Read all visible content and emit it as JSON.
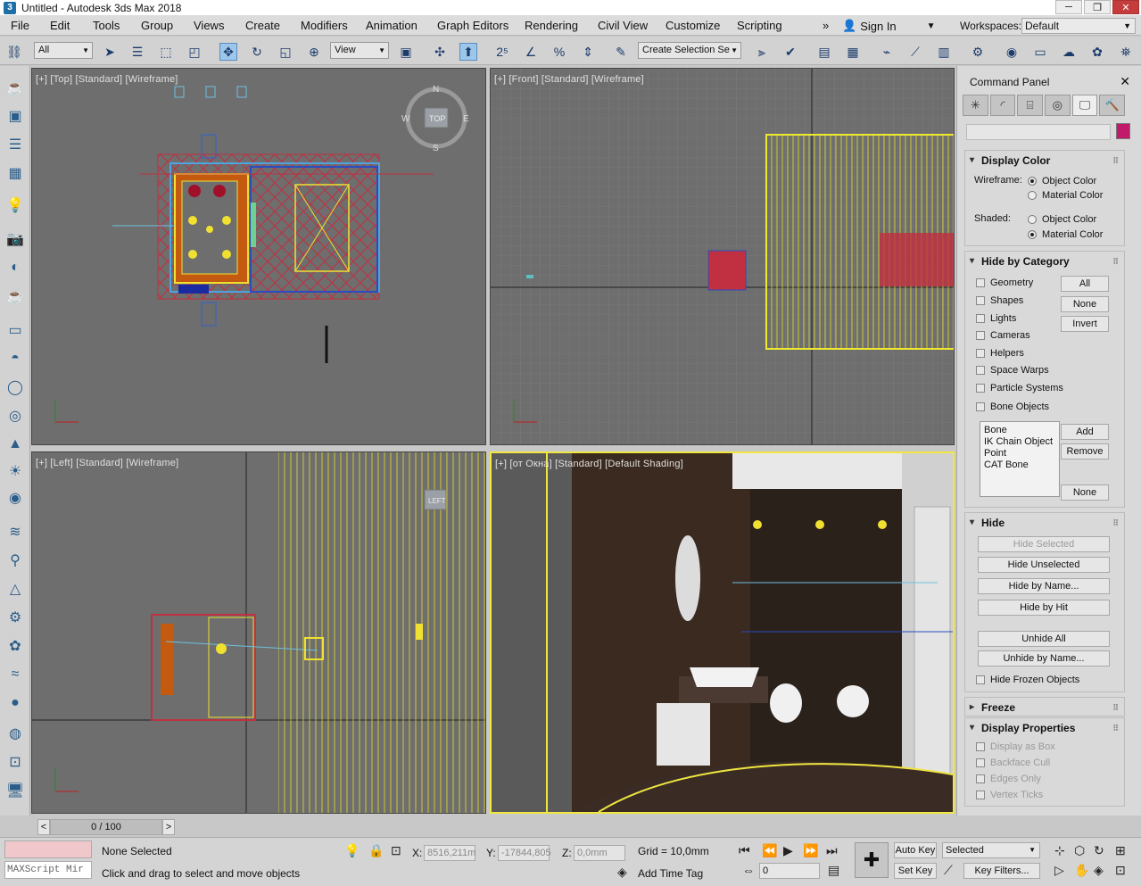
{
  "window": {
    "title": "Untitled - Autodesk 3ds Max 2018",
    "app_icon": "3"
  },
  "menu": {
    "items": [
      "File",
      "Edit",
      "Tools",
      "Group",
      "Views",
      "Create",
      "Modifiers",
      "Animation",
      "Graph Editors",
      "Rendering",
      "Civil View",
      "Customize",
      "Scripting"
    ],
    "overflow": "»",
    "sign_in": "Sign In",
    "workspaces_label": "Workspaces:",
    "workspace": "Default"
  },
  "toolbar": {
    "filter": "All",
    "ref_coord": "View",
    "selection_set": "Create Selection Se"
  },
  "viewports": {
    "top": {
      "label": "[+] [Top] [Standard] [Wireframe]",
      "cube": "TOP",
      "compass_n": "N",
      "compass_s": "S",
      "compass_e": "E",
      "compass_w": "W"
    },
    "front": {
      "label": "[+] [Front] [Standard] [Wireframe]"
    },
    "left": {
      "label": "[+] [Left] [Standard] [Wireframe]",
      "cube": "LEFT"
    },
    "persp": {
      "label": "[+] [от Окна] [Standard] [Default Shading]"
    }
  },
  "command_panel": {
    "title": "Command Panel",
    "display_color": {
      "header": "Display Color",
      "wireframe_label": "Wireframe:",
      "shaded_label": "Shaded:",
      "object_color": "Object Color",
      "material_color": "Material Color"
    },
    "hide_by_category": {
      "header": "Hide by Category",
      "items": [
        "Geometry",
        "Shapes",
        "Lights",
        "Cameras",
        "Helpers",
        "Space Warps",
        "Particle Systems",
        "Bone Objects"
      ],
      "all": "All",
      "none": "None",
      "invert": "Invert",
      "list": [
        "Bone",
        "IK Chain Object",
        "Point",
        "CAT Bone"
      ],
      "add": "Add",
      "remove": "Remove",
      "none2": "None"
    },
    "hide": {
      "header": "Hide",
      "hide_selected": "Hide Selected",
      "hide_unselected": "Hide Unselected",
      "hide_by_name": "Hide by Name...",
      "hide_by_hit": "Hide by Hit",
      "unhide_all": "Unhide All",
      "unhide_by_name": "Unhide by Name...",
      "hide_frozen": "Hide Frozen Objects"
    },
    "freeze": {
      "header": "Freeze"
    },
    "display_properties": {
      "header": "Display Properties",
      "items": [
        "Display as Box",
        "Backface Cull",
        "Edges Only",
        "Vertex Ticks"
      ]
    }
  },
  "timeline": {
    "frame": "0 / 100",
    "prev": "<",
    "next": ">"
  },
  "status": {
    "maxscript": "MAXScript Mir",
    "selection": "None Selected",
    "prompt": "Click and drag to select and move objects",
    "x_label": "X:",
    "x": "8516,211m",
    "y_label": "Y:",
    "y": "-17844,805",
    "z_label": "Z:",
    "z": "0,0mm",
    "grid": "Grid = 10,0mm",
    "add_time_tag": "Add Time Tag",
    "auto_key": "Auto Key",
    "set_key": "Set Key",
    "key_mode": "Selected",
    "key_filters": "Key Filters...",
    "frame_field": "0"
  },
  "colors": {
    "accent": "#f2e640",
    "bg": "#6e6e6e",
    "persp_bg": "#2b211b"
  }
}
